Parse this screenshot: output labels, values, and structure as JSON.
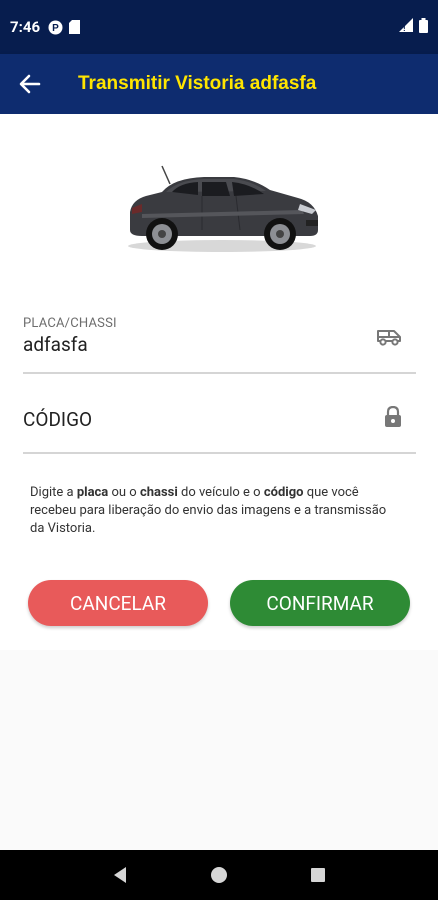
{
  "status_bar": {
    "time": "7:46",
    "icons": [
      "notification-p-icon",
      "sd-card-icon",
      "signal-icon",
      "battery-icon"
    ]
  },
  "app_bar": {
    "title": "Transmitir Vistoria adfasfa",
    "back_icon": "arrow-back-icon",
    "title_color": "#ffe500",
    "background": "#0e2c6f"
  },
  "form": {
    "placa_label": "PLACA/CHASSI",
    "placa_value": "adfasfa",
    "placa_icon": "van-icon",
    "codigo_placeholder": "CÓDIGO",
    "codigo_icon": "lock-icon"
  },
  "hint": {
    "part1": "Digite a ",
    "bold1": "placa",
    "part2": " ou o ",
    "bold2": "chassi",
    "part3": " do veículo e o ",
    "bold3": "código",
    "part4": " que você recebeu para liberação do envio das imagens e a transmissão da Vistoria."
  },
  "buttons": {
    "cancel_label": "CANCELAR",
    "confirm_label": "CONFIRMAR",
    "cancel_color": "#e85a5a",
    "confirm_color": "#2e8b35"
  },
  "nav_bar": {
    "icons": [
      "back-triangle-icon",
      "home-circle-icon",
      "recents-square-icon"
    ]
  }
}
